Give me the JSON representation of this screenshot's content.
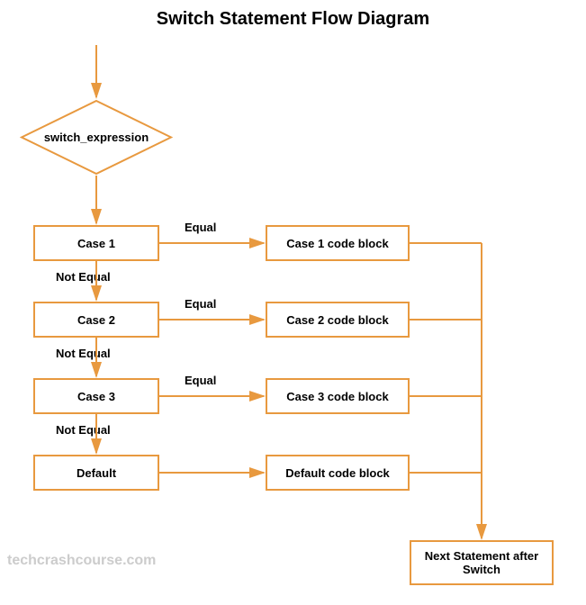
{
  "title": "Switch Statement Flow Diagram",
  "decision": "switch_expression",
  "cases": [
    {
      "name": "Case 1",
      "block": "Case 1 code block",
      "equal": "Equal",
      "notequal": "Not Equal"
    },
    {
      "name": "Case 2",
      "block": "Case 2 code block",
      "equal": "Equal",
      "notequal": "Not Equal"
    },
    {
      "name": "Case 3",
      "block": "Case 3 code block",
      "equal": "Equal",
      "notequal": "Not Equal"
    }
  ],
  "default_case": {
    "name": "Default",
    "block": "Default code block"
  },
  "next_statement": "Next Statement after Switch",
  "watermark": "techcrashcourse.com",
  "colors": {
    "line": "#e8993f"
  }
}
